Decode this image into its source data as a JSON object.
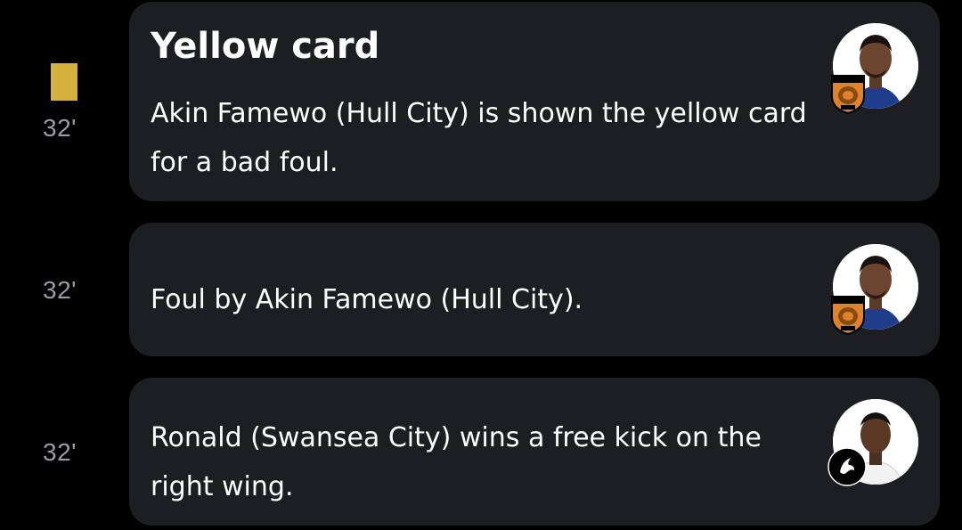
{
  "events": [
    {
      "minute": "32'",
      "card_type": "yellow",
      "title": "Yellow card",
      "text": "Akin Famewo (Hull City) is shown the yellow card for a bad foul.",
      "avatar_icon": "player-avatar",
      "badge_icon": "hull-city-badge-icon"
    },
    {
      "minute": "32'",
      "title": "",
      "text": "Foul by Akin Famewo (Hull City).",
      "avatar_icon": "player-avatar",
      "badge_icon": "hull-city-badge-icon"
    },
    {
      "minute": "32'",
      "title": "",
      "text": "Ronald (Swansea City) wins a free kick on the right wing.",
      "avatar_icon": "player-avatar",
      "badge_icon": "swansea-city-badge-icon"
    }
  ],
  "colors": {
    "background": "#000000",
    "card": "#1c1e22",
    "minute_text": "#9a9ca1",
    "yellow_card": "#d4b03c",
    "hull_orange": "#e0822b",
    "text": "#ffffff"
  }
}
